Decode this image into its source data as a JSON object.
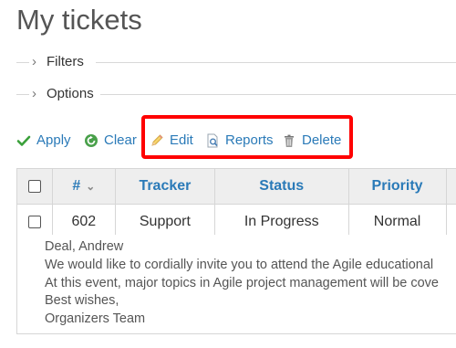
{
  "page": {
    "title": "My tickets"
  },
  "filters": {
    "label": "Filters"
  },
  "options": {
    "label": "Options"
  },
  "toolbar": {
    "apply": "Apply",
    "clear": "Clear",
    "edit": "Edit",
    "reports": "Reports",
    "delete": "Delete"
  },
  "colors": {
    "accent": "#2a7ab8",
    "highlight": "#ff0000",
    "header_bg": "#eeeeee",
    "apply_icon": "#3aa03a",
    "clear_icon": "#49a04a"
  },
  "table": {
    "headers": {
      "number": "#",
      "tracker": "Tracker",
      "status": "Status",
      "priority": "Priority"
    },
    "rows": [
      {
        "number": "602",
        "tracker": "Support",
        "status": "In Progress",
        "priority": "Normal"
      }
    ]
  },
  "description": {
    "lines": [
      "Deal, Andrew",
      "We would like to cordially invite you to attend the Agile educational",
      "At this event, major topics in Agile project management will be cove",
      "Best wishes,",
      "Organizers Team"
    ]
  }
}
